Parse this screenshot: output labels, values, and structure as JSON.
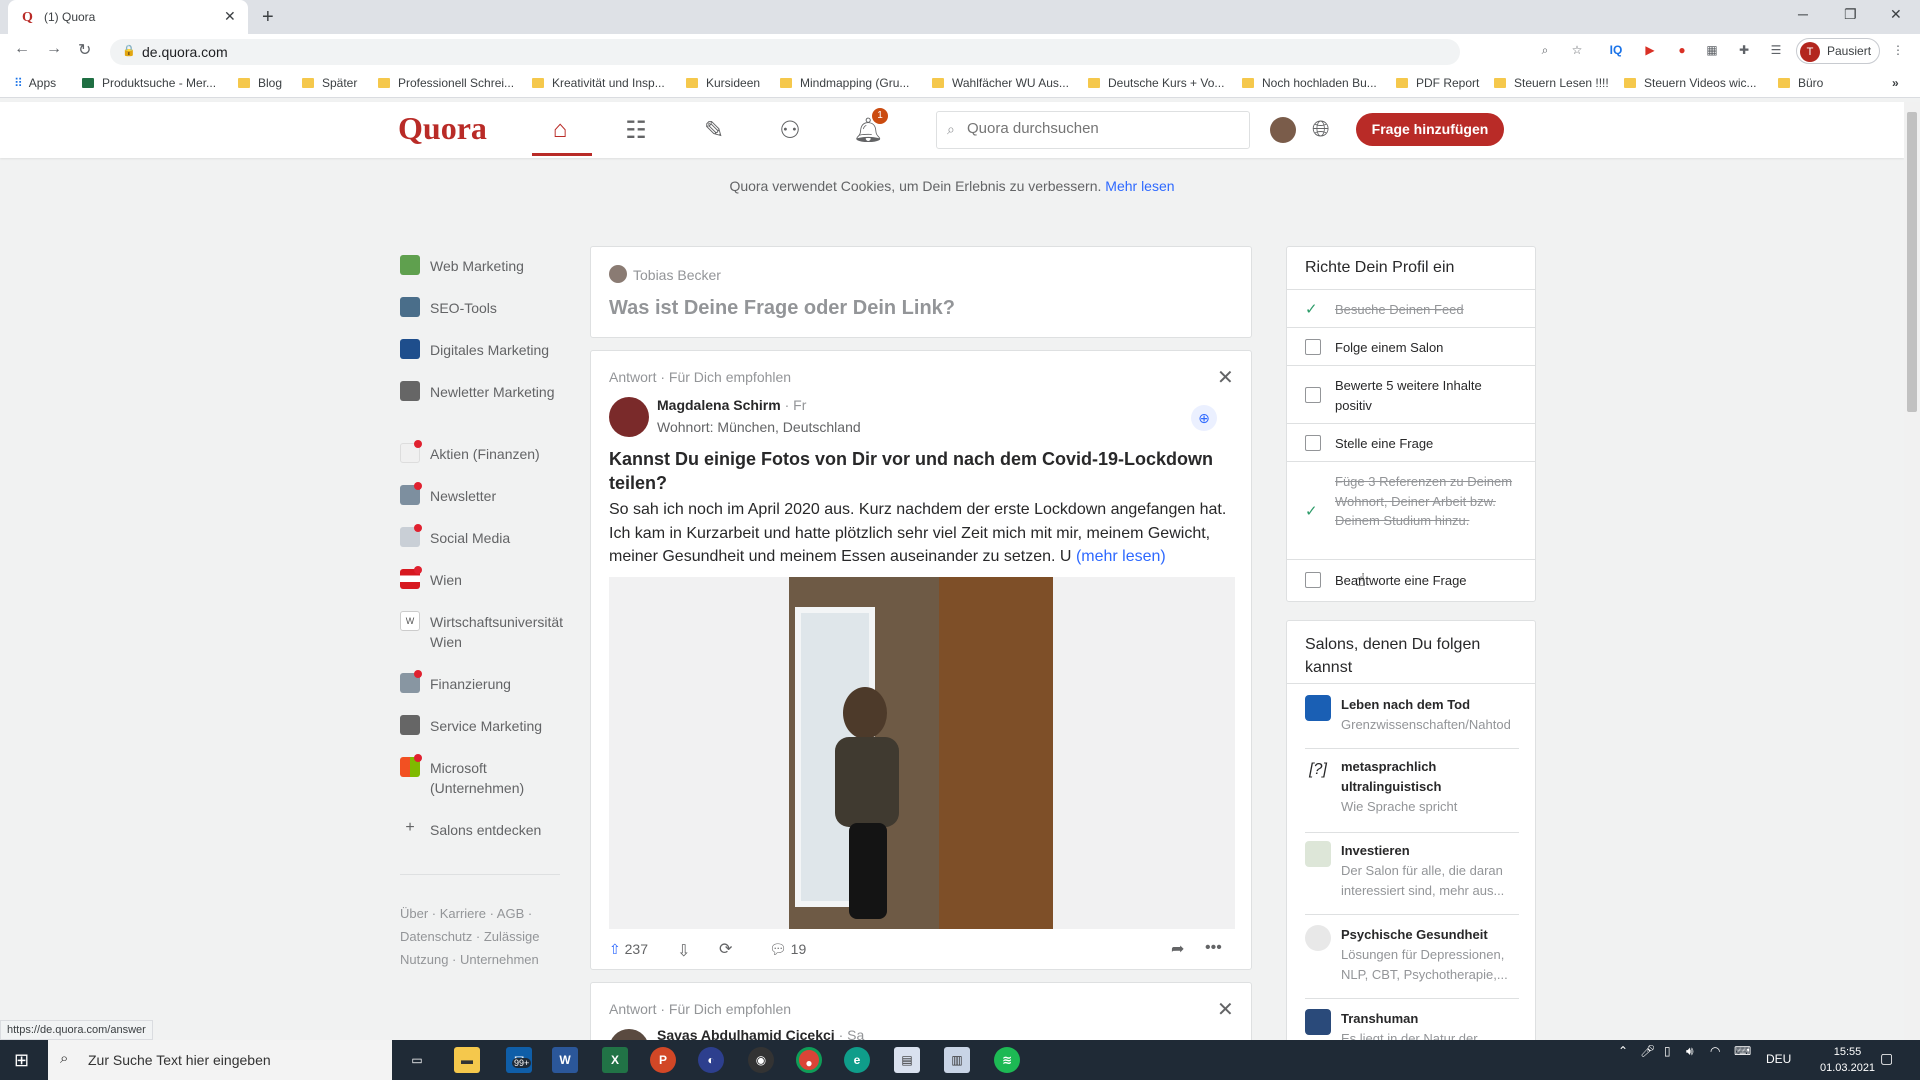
{
  "browser": {
    "tab_title": "(1) Quora",
    "url": "de.quora.com",
    "profile_status": "Pausiert",
    "profile_initial": "T",
    "bookmarks": [
      "Apps",
      "Produktsuche - Mer...",
      "Blog",
      "Später",
      "Professionell Schrei...",
      "Kreativität und Insp...",
      "Kursideen",
      "Mindmapping  (Gru...",
      "Wahlfächer WU Aus...",
      "Deutsche Kurs + Vo...",
      "Noch hochladen Bu...",
      "PDF Report",
      "Steuern Lesen !!!!",
      "Steuern Videos wic...",
      "Büro"
    ],
    "status_url": "https://de.quora.com/answer"
  },
  "header": {
    "logo": "Quora",
    "search_placeholder": "Quora durchsuchen",
    "notification_count": "1",
    "add_question": "Frage hinzufügen"
  },
  "cookie": {
    "text": "Quora verwendet Cookies, um Dein Erlebnis zu verbessern.",
    "link": "Mehr lesen"
  },
  "sidebar": {
    "items": [
      {
        "label": "Web Marketing",
        "color": "#5fa04e",
        "dot": false
      },
      {
        "label": "SEO-Tools",
        "color": "#4a6e8a",
        "dot": false
      },
      {
        "label": "Digitales Marketing",
        "color": "#1e4e8c",
        "dot": false
      },
      {
        "label": "Newletter Marketing",
        "color": "#666666",
        "dot": false
      },
      {
        "label": "Aktien (Finanzen)",
        "color": "#f0f0f0",
        "dot": true
      },
      {
        "label": "Newsletter",
        "color": "#7d8f9f",
        "dot": true
      },
      {
        "label": "Social Media",
        "color": "#c9cfd6",
        "dot": true
      },
      {
        "label": "Wien",
        "color": "#d71920",
        "dot": true
      },
      {
        "label": "Wirtschaftsuniversität Wien",
        "color": "#555555",
        "dot": false
      },
      {
        "label": "Finanzierung",
        "color": "#8896a2",
        "dot": true
      },
      {
        "label": "Service Marketing",
        "color": "#666666",
        "dot": false
      },
      {
        "label": "Microsoft (Unternehmen)",
        "color": "#f25022",
        "dot": true
      },
      {
        "label": "Salons entdecken",
        "color": "",
        "dot": false
      }
    ],
    "footer": "Über · Karriere · AGB · Datenschutz · Zulässige Nutzung · Unternehmen"
  },
  "asker": {
    "name": "Tobias Becker",
    "prompt": "Was ist Deine Frage oder Dein Link?"
  },
  "post": {
    "meta": "Antwort · Für Dich empfohlen",
    "author": "Magdalena Schirm",
    "author_time": "· Fr",
    "author_detail": "Wohnort: München, Deutschland",
    "question": "Kannst Du einige Fotos von Dir vor und nach dem Covid-19-Lockdown teilen?",
    "body": "So sah ich noch im April 2020 aus. Kurz nachdem der erste Lockdown angefangen hat. Ich kam in Kurzarbeit und hatte plötzlich sehr viel Zeit mich mit mir, meinem Gewicht, meiner Gesundheit und meinem Essen auseinander zu setzen. U",
    "more": "(mehr lesen)",
    "upvotes": "237",
    "comments": "19"
  },
  "post2": {
    "meta": "Antwort · Für Dich empfohlen",
    "author": "Savas Abdulhamid Cicekci",
    "author_time": "· Sa"
  },
  "profile": {
    "title": "Richte Dein Profil ein",
    "tasks": [
      {
        "label": "Besuche Deinen Feed",
        "done": true
      },
      {
        "label": "Folge einem Salon",
        "done": false
      },
      {
        "label": "Bewerte 5 weitere Inhalte positiv",
        "done": false
      },
      {
        "label": "Stelle eine Frage",
        "done": false
      },
      {
        "label": "Füge 3 Referenzen zu Deinem Wohnort, Deiner Arbeit bzw. Deinem Studium hinzu.",
        "done": true
      },
      {
        "label": "Beantworte eine Frage",
        "done": false
      }
    ]
  },
  "salons": {
    "title": "Salons, denen Du folgen kannst",
    "items": [
      {
        "name": "Leben nach dem Tod",
        "desc": "Grenzwissenschaften/Nahtod",
        "color": "#1a5fb4"
      },
      {
        "name": "metasprachlich ultralinguistisch",
        "desc": "Wie Sprache spricht",
        "icon": "[?]",
        "color": "#ffffff"
      },
      {
        "name": "Investieren",
        "desc": "Der Salon für alle, die daran interessiert sind, mehr aus...",
        "color": "#dde6d8"
      },
      {
        "name": "Psychische Gesundheit",
        "desc": "Lösungen für Depressionen, NLP, CBT, Psychotherapie,...",
        "color": "#e8e8e8"
      },
      {
        "name": "Transhuman",
        "desc": "Es liegt in der Natur der",
        "color": "#2a4a7a"
      }
    ]
  },
  "taskbar": {
    "search_placeholder": "Zur Suche Text hier eingeben",
    "mail_badge": "99+",
    "lang": "DEU",
    "time": "15:55",
    "date": "01.03.2021"
  }
}
